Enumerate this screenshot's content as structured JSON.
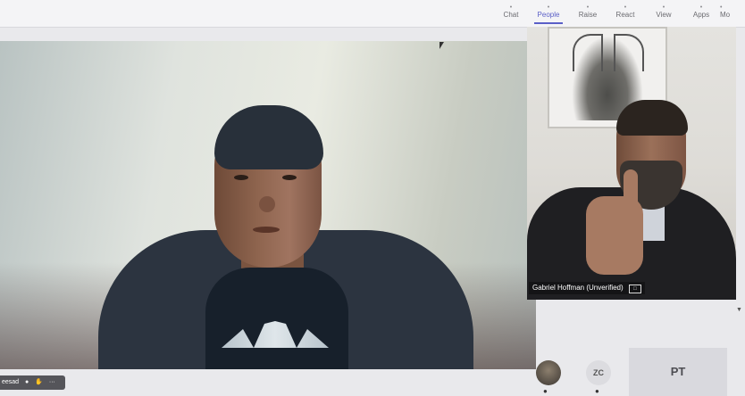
{
  "toolbar": {
    "items": [
      {
        "label": "Chat",
        "icon": "chat-icon"
      },
      {
        "label": "People",
        "icon": "people-icon",
        "active": true
      },
      {
        "label": "Raise",
        "icon": "raise-hand-icon"
      },
      {
        "label": "React",
        "icon": "react-icon"
      },
      {
        "label": "View",
        "icon": "view-icon"
      },
      {
        "label": "Apps",
        "icon": "apps-icon"
      },
      {
        "label": "Mo",
        "icon": "more-icon"
      }
    ]
  },
  "side_video": {
    "name": "Gabriel Hoffman (Unverified)"
  },
  "participants": {
    "zc": "ZC",
    "pt": "PT"
  },
  "self_bar": {
    "name": "eesad",
    "more": "···"
  },
  "colors": {
    "accent": "#5b5fc7"
  }
}
